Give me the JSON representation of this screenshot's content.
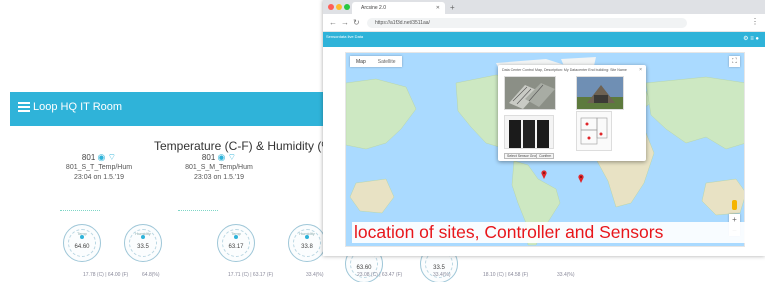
{
  "dashboard": {
    "title": "Loop HQ IT Room",
    "subtitle": "Temperature (C-F) & Humidity (%)",
    "sensors": [
      {
        "line1": "801",
        "line2": "801_S_T_Temp/Hum",
        "line3": "23:04 on 1.5.'19"
      },
      {
        "line1": "801",
        "line2": "801_S_M_Temp/Hum",
        "line3": "23:03 on 1.5.'19"
      }
    ],
    "gauges": [
      {
        "label": "Temp",
        "value": "64.60"
      },
      {
        "label": "Humidity",
        "value": "33.5"
      },
      {
        "label": "Temp",
        "value": "63.17"
      },
      {
        "label": "Humidity",
        "value": "33.8"
      },
      {
        "label": "Temp",
        "value": "63.60"
      },
      {
        "label": "Humidity",
        "value": "33.5"
      }
    ],
    "readings": [
      "17.78 (C) | 64.00 (F)",
      "64.8(%)",
      "17.71 (C) | 63.17 (F)",
      "33.4(%)",
      "23.08 (C) | 63.47 (F)",
      "33.4(%)",
      "18.10 (C) | 64.58 (F)",
      "33.4(%)"
    ]
  },
  "browser": {
    "tab_title": "Arcsine 2.0",
    "url": "https://a1f3d.net/3511aa/",
    "app_title": "Sensordata live Data",
    "app_icons": "⚙ ≡ ●"
  },
  "map": {
    "tab_map": "Map",
    "tab_satellite": "Satellite",
    "fullscreen_icon": "⛶",
    "zoom_in": "+",
    "zoom_out": "−",
    "pin_color": "#e0262a"
  },
  "popup": {
    "title": "Data Center Control Map, Description: My Datacenter End building: Site Name",
    "close": "×",
    "button_left": "Select Sensor Group",
    "button_right": "Confirm"
  },
  "caption": "location of sites, Controller and Sensors"
}
